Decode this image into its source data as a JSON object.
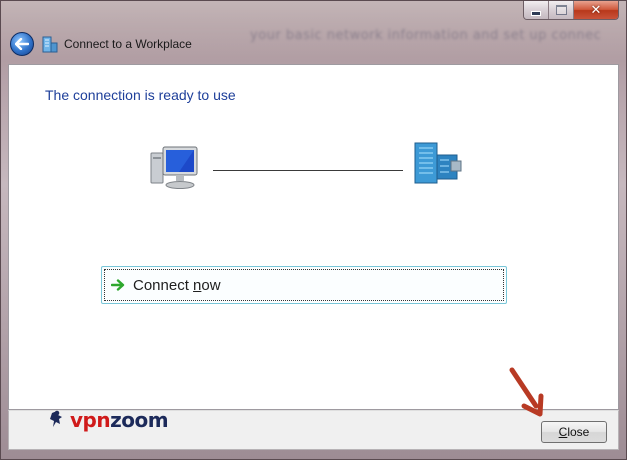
{
  "window": {
    "title": "Connect to a Workplace",
    "background_blur_text": "your basic network information and set up connec"
  },
  "controls": {
    "minimize_icon": "minimize-icon",
    "maximize_icon": "maximize-icon",
    "close_glyph": "✕"
  },
  "content": {
    "heading": "The connection is ready to use",
    "connect_action": {
      "label_pre": "Connect ",
      "label_underlined": "n",
      "label_post": "ow",
      "icon": "green-arrow-icon"
    }
  },
  "footer": {
    "brand": {
      "part1": "vpn",
      "part2": "zoom"
    },
    "close_button": {
      "label_underlined": "C",
      "label_rest": "lose"
    }
  },
  "colors": {
    "heading": "#1e3f9a",
    "link_border": "#79c6d8",
    "arrow": "#2ea82e",
    "annotation_arrow": "#c0392b",
    "brand_red": "#d01a1a",
    "brand_navy": "#1c2a5a"
  }
}
